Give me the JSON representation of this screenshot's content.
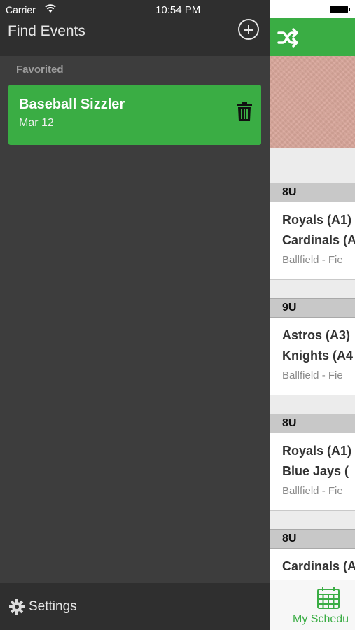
{
  "status_bar": {
    "carrier": "Carrier",
    "time": "10:54 PM"
  },
  "drawer": {
    "title": "Find Events",
    "section_label": "Favorited",
    "favorites": [
      {
        "name": "Baseball Sizzler",
        "date": "Mar 12"
      }
    ],
    "footer": {
      "label": "Settings"
    }
  },
  "main": {
    "games": [
      {
        "division": "8U",
        "team1": "Royals (A1)",
        "team2": "Cardinals (A",
        "location": "Ballfield - Fie"
      },
      {
        "division": "9U",
        "team1": "Astros (A3)",
        "team2": "Knights (A4",
        "location": "Ballfield - Fie"
      },
      {
        "division": "8U",
        "team1": "Royals (A1)",
        "team2": "Blue Jays (",
        "location": "Ballfield - Fie"
      },
      {
        "division": "8U",
        "team1": "Cardinals (A",
        "team2": "",
        "location": ""
      }
    ],
    "tab_label": "My Schedu"
  },
  "colors": {
    "accent": "#3aad44",
    "drawer_bg": "#3d3d3d",
    "drawer_header": "#2f2f2f"
  },
  "icons": [
    "wifi-icon",
    "add-circle-icon",
    "trash-icon",
    "gear-icon",
    "shuffle-icon",
    "calendar-icon",
    "battery-icon"
  ]
}
